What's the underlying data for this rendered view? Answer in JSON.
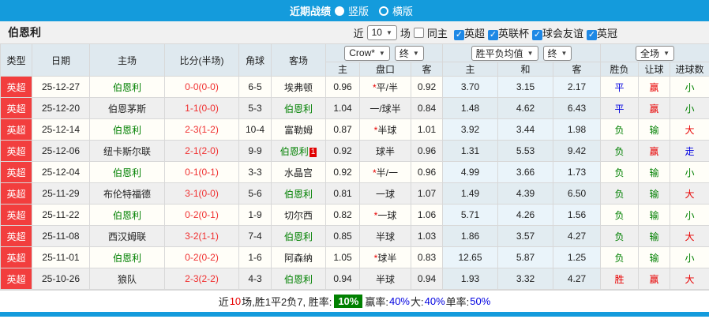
{
  "topbar": {
    "title": "近期战绩",
    "radios": [
      {
        "label": "竖版",
        "checked": true
      },
      {
        "label": "横版",
        "checked": false
      }
    ]
  },
  "filter": {
    "team": "伯恩利",
    "near_label": "近",
    "rounds_value": "10",
    "games_label": "场",
    "same_home": {
      "label": "同主",
      "checked": false
    },
    "leagues": [
      {
        "label": "英超",
        "checked": true
      },
      {
        "label": "英联杯",
        "checked": true
      },
      {
        "label": "球会友谊",
        "checked": true
      },
      {
        "label": "英冠",
        "checked": true
      }
    ]
  },
  "table": {
    "headers": {
      "type": "类型",
      "date": "日期",
      "home": "主场",
      "score": "比分(半场)",
      "corner": "角球",
      "away": "客场",
      "sub": [
        "主",
        "盘口",
        "客",
        "主",
        "和",
        "客",
        "胜负",
        "让球",
        "进球数"
      ]
    },
    "selects": {
      "bookmaker": "Crow*",
      "time1": "终",
      "avg": "胜平负均值",
      "time2": "终",
      "scope": "全场"
    },
    "rows": [
      {
        "league": "英超",
        "date": "25-12-27",
        "home": {
          "name": "伯恩利",
          "self": true
        },
        "score": "0-0(0-0)",
        "corner": "6-5",
        "away": {
          "name": "埃弗顿",
          "self": false
        },
        "odds_home": "0.96",
        "handicap": {
          "star": true,
          "text": "平/半"
        },
        "odds_away": "0.92",
        "avg": [
          "3.70",
          "3.15",
          "2.17"
        ],
        "wdl": {
          "text": "平",
          "color": "blue"
        },
        "hcp": {
          "text": "赢",
          "color": "red"
        },
        "ou": {
          "text": "小",
          "color": "green"
        }
      },
      {
        "league": "英超",
        "date": "25-12-20",
        "home": {
          "name": "伯恩茅斯",
          "self": false
        },
        "score": "1-1(0-0)",
        "corner": "5-3",
        "away": {
          "name": "伯恩利",
          "self": true
        },
        "odds_home": "1.04",
        "handicap": {
          "star": false,
          "text": "一/球半"
        },
        "odds_away": "0.84",
        "avg": [
          "1.48",
          "4.62",
          "6.43"
        ],
        "wdl": {
          "text": "平",
          "color": "blue"
        },
        "hcp": {
          "text": "赢",
          "color": "red"
        },
        "ou": {
          "text": "小",
          "color": "green"
        }
      },
      {
        "league": "英超",
        "date": "25-12-14",
        "home": {
          "name": "伯恩利",
          "self": true
        },
        "score": "2-3(1-2)",
        "corner": "10-4",
        "away": {
          "name": "富勒姆",
          "self": false
        },
        "odds_home": "0.87",
        "handicap": {
          "star": true,
          "text": "半球"
        },
        "odds_away": "1.01",
        "avg": [
          "3.92",
          "3.44",
          "1.98"
        ],
        "wdl": {
          "text": "负",
          "color": "green"
        },
        "hcp": {
          "text": "输",
          "color": "green"
        },
        "ou": {
          "text": "大",
          "color": "red"
        }
      },
      {
        "league": "英超",
        "date": "25-12-06",
        "home": {
          "name": "纽卡斯尔联",
          "self": false
        },
        "score": "2-1(2-0)",
        "corner": "9-9",
        "away": {
          "name": "伯恩利",
          "self": true,
          "badge": "1"
        },
        "odds_home": "0.92",
        "handicap": {
          "star": false,
          "text": "球半"
        },
        "odds_away": "0.96",
        "avg": [
          "1.31",
          "5.53",
          "9.42"
        ],
        "wdl": {
          "text": "负",
          "color": "green"
        },
        "hcp": {
          "text": "赢",
          "color": "red"
        },
        "ou": {
          "text": "走",
          "color": "blue"
        }
      },
      {
        "league": "英超",
        "date": "25-12-04",
        "home": {
          "name": "伯恩利",
          "self": true
        },
        "score": "0-1(0-1)",
        "corner": "3-3",
        "away": {
          "name": "水晶宫",
          "self": false
        },
        "odds_home": "0.92",
        "handicap": {
          "star": true,
          "text": "半/一"
        },
        "odds_away": "0.96",
        "avg": [
          "4.99",
          "3.66",
          "1.73"
        ],
        "wdl": {
          "text": "负",
          "color": "green"
        },
        "hcp": {
          "text": "输",
          "color": "green"
        },
        "ou": {
          "text": "小",
          "color": "green"
        }
      },
      {
        "league": "英超",
        "date": "25-11-29",
        "home": {
          "name": "布伦特福德",
          "self": false
        },
        "score": "3-1(0-0)",
        "corner": "5-6",
        "away": {
          "name": "伯恩利",
          "self": true
        },
        "odds_home": "0.81",
        "handicap": {
          "star": false,
          "text": "一球"
        },
        "odds_away": "1.07",
        "avg": [
          "1.49",
          "4.39",
          "6.50"
        ],
        "wdl": {
          "text": "负",
          "color": "green"
        },
        "hcp": {
          "text": "输",
          "color": "green"
        },
        "ou": {
          "text": "大",
          "color": "red"
        }
      },
      {
        "league": "英超",
        "date": "25-11-22",
        "home": {
          "name": "伯恩利",
          "self": true
        },
        "score": "0-2(0-1)",
        "corner": "1-9",
        "away": {
          "name": "切尔西",
          "self": false
        },
        "odds_home": "0.82",
        "handicap": {
          "star": true,
          "text": "一球"
        },
        "odds_away": "1.06",
        "avg": [
          "5.71",
          "4.26",
          "1.56"
        ],
        "wdl": {
          "text": "负",
          "color": "green"
        },
        "hcp": {
          "text": "输",
          "color": "green"
        },
        "ou": {
          "text": "小",
          "color": "green"
        }
      },
      {
        "league": "英超",
        "date": "25-11-08",
        "home": {
          "name": "西汉姆联",
          "self": false
        },
        "score": "3-2(1-1)",
        "corner": "7-4",
        "away": {
          "name": "伯恩利",
          "self": true
        },
        "odds_home": "0.85",
        "handicap": {
          "star": false,
          "text": "半球"
        },
        "odds_away": "1.03",
        "avg": [
          "1.86",
          "3.57",
          "4.27"
        ],
        "wdl": {
          "text": "负",
          "color": "green"
        },
        "hcp": {
          "text": "输",
          "color": "green"
        },
        "ou": {
          "text": "大",
          "color": "red"
        }
      },
      {
        "league": "英超",
        "date": "25-11-01",
        "home": {
          "name": "伯恩利",
          "self": true
        },
        "score": "0-2(0-2)",
        "corner": "1-6",
        "away": {
          "name": "阿森纳",
          "self": false
        },
        "odds_home": "1.05",
        "handicap": {
          "star": true,
          "text": "球半"
        },
        "odds_away": "0.83",
        "avg": [
          "12.65",
          "5.87",
          "1.25"
        ],
        "wdl": {
          "text": "负",
          "color": "green"
        },
        "hcp": {
          "text": "输",
          "color": "green"
        },
        "ou": {
          "text": "小",
          "color": "green"
        }
      },
      {
        "league": "英超",
        "date": "25-10-26",
        "home": {
          "name": "狼队",
          "self": false
        },
        "score": "2-3(2-2)",
        "corner": "4-3",
        "away": {
          "name": "伯恩利",
          "self": true
        },
        "odds_home": "0.94",
        "handicap": {
          "star": false,
          "text": "半球"
        },
        "odds_away": "0.94",
        "avg": [
          "1.93",
          "3.32",
          "4.27"
        ],
        "wdl": {
          "text": "胜",
          "color": "red"
        },
        "hcp": {
          "text": "赢",
          "color": "red"
        },
        "ou": {
          "text": "大",
          "color": "red"
        }
      }
    ]
  },
  "footer": {
    "parts": [
      {
        "text": "近",
        "style": "black"
      },
      {
        "text": "10",
        "style": "red"
      },
      {
        "text": "场,胜1平2负7, 胜率:",
        "style": "black"
      },
      {
        "text": "10%",
        "style": "badge"
      },
      {
        "text": "赢率:",
        "style": "black"
      },
      {
        "text": "40%",
        "style": "blue"
      },
      {
        "text": " 大:",
        "style": "black"
      },
      {
        "text": "40%",
        "style": "blue"
      },
      {
        "text": " 单率:",
        "style": "black"
      },
      {
        "text": "50%",
        "style": "blue"
      }
    ]
  },
  "colors": {
    "bar_blue": "#149BDC",
    "badge_red": "#F23E3E",
    "win_red": "#E80000",
    "lose_green": "#008000",
    "draw_blue": "#0000E0",
    "pct_green": "#008000"
  }
}
